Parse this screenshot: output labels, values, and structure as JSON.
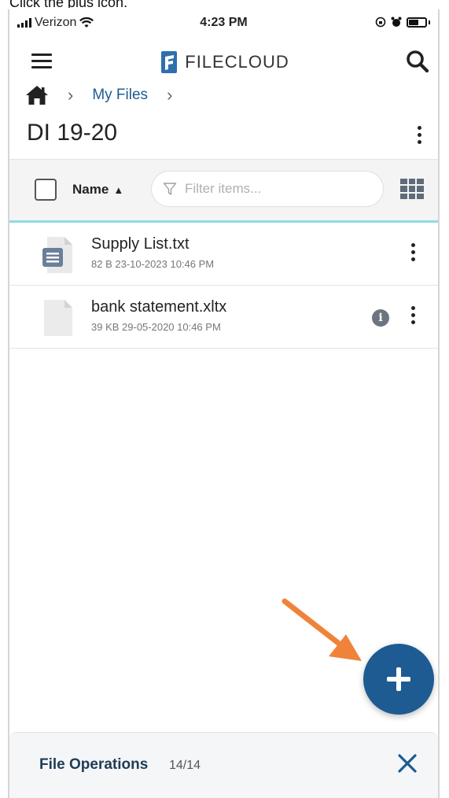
{
  "caption": "Click the plus icon.",
  "status_bar": {
    "carrier": "Verizon",
    "time": "4:23 PM"
  },
  "header": {
    "brand": "FILECLOUD",
    "menu_icon": "hamburger-icon",
    "search_icon": "search-icon"
  },
  "breadcrumb": {
    "home_icon": "home-icon",
    "items": [
      "My Files"
    ]
  },
  "folder": {
    "title": "DI 19-20"
  },
  "toolbar": {
    "sort_label": "Name",
    "sort_direction": "ascending",
    "filter_placeholder": "Filter items..."
  },
  "files": [
    {
      "name": "Supply List.txt",
      "meta": "82 B 23-10-2023 10:46 PM",
      "icon": "text-file-icon",
      "has_info": false
    },
    {
      "name": "bank statement.xltx",
      "meta": "39 KB 29-05-2020 10:46 PM",
      "icon": "generic-file-icon",
      "has_info": true
    }
  ],
  "fab": {
    "icon": "plus-icon"
  },
  "file_operations": {
    "title": "File Operations",
    "count": "14/14"
  },
  "colors": {
    "accent": "#1e5b93",
    "link": "#1d5c92",
    "arrow": "#f0833a",
    "divider_accent": "#8fdde0"
  }
}
